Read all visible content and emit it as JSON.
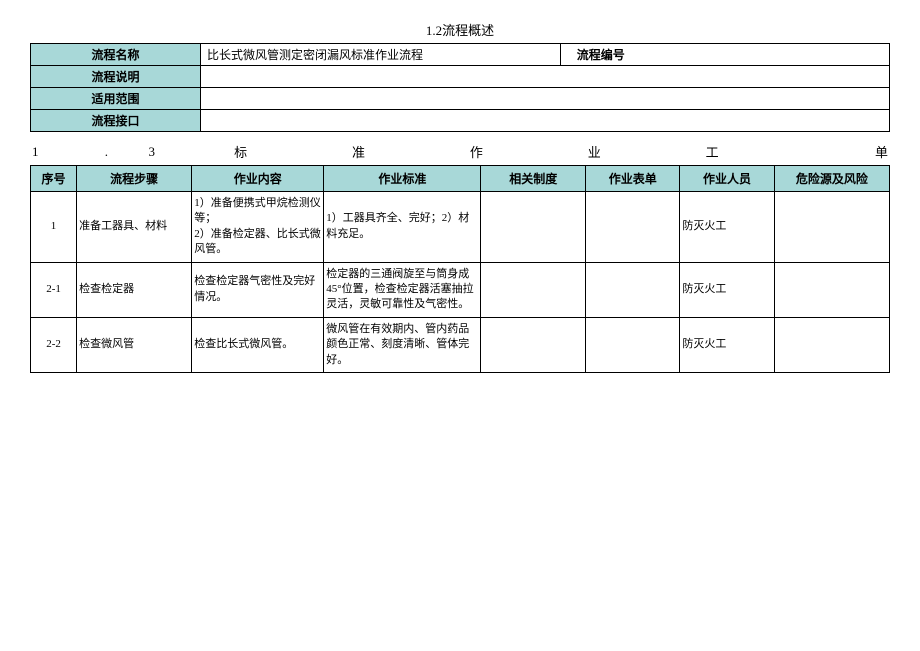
{
  "section_title": "1.2流程概述",
  "overview": {
    "labels": {
      "name": "流程名称",
      "desc": "流程说明",
      "scope": "适用范围",
      "interface": "流程接口",
      "code": "流程编号"
    },
    "values": {
      "name": "比长式微风管测定密闭漏风标准作业流程",
      "desc": "",
      "scope": "",
      "interface": "",
      "code": ""
    }
  },
  "section2_parts": [
    "1",
    ".",
    "3",
    "标",
    "准",
    "作",
    "业",
    "工",
    "单"
  ],
  "headers": {
    "seq": "序号",
    "step": "流程步骤",
    "content": "作业内容",
    "standard": "作业标准",
    "system": "相关制度",
    "form": "作业表单",
    "person": "作业人员",
    "risk": "危险源及风险"
  },
  "rows": [
    {
      "seq": "1",
      "step": "准备工器具、材料",
      "content": "1）准备便携式甲烷检测仪等；\n2）准备检定器、比长式微风管。",
      "standard": "1）工器具齐全、完好；2）材料充足。",
      "system": "",
      "form": "",
      "person": "防灭火工",
      "risk": ""
    },
    {
      "seq": "2-1",
      "step": "检查检定器",
      "content": "检查检定器气密性及完好情况。",
      "standard": "检定器的三通阀旋至与筒身成45°位置，检查检定器活塞抽拉灵活，灵敏可靠性及气密性。",
      "system": "",
      "form": "",
      "person": "防灭火工",
      "risk": ""
    },
    {
      "seq": "2-2",
      "step": "检查微风管",
      "content": "检查比长式微风管。",
      "standard": "微风管在有效期内、管内药品颜色正常、刻度清晰、管体完好。",
      "system": "",
      "form": "",
      "person": "防灭火工",
      "risk": ""
    }
  ]
}
